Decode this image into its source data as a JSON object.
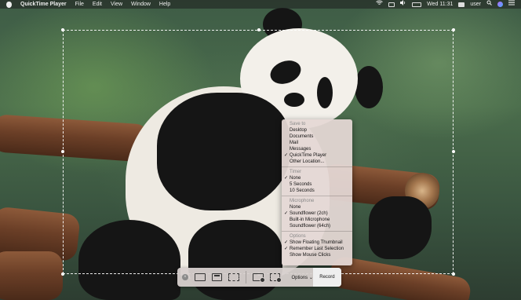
{
  "menubar": {
    "app_name": "QuickTime Player",
    "menus": [
      "File",
      "Edit",
      "View",
      "Window",
      "Help"
    ],
    "clock": "Wed 11:31",
    "user": "user"
  },
  "options_menu": {
    "save_to": {
      "header": "Save to",
      "items": [
        {
          "label": "Desktop",
          "checked": false
        },
        {
          "label": "Documents",
          "checked": false
        },
        {
          "label": "Mail",
          "checked": false
        },
        {
          "label": "Messages",
          "checked": false
        },
        {
          "label": "QuickTime Player",
          "checked": true
        },
        {
          "label": "Other Location...",
          "checked": false
        }
      ]
    },
    "timer": {
      "header": "Timer",
      "items": [
        {
          "label": "None",
          "checked": true
        },
        {
          "label": "5 Seconds",
          "checked": false
        },
        {
          "label": "10 Seconds",
          "checked": false
        }
      ]
    },
    "microphone": {
      "header": "Microphone",
      "items": [
        {
          "label": "None",
          "checked": false
        },
        {
          "label": "Soundflower (2ch)",
          "checked": true
        },
        {
          "label": "Built-in Microphone",
          "checked": false
        },
        {
          "label": "Soundflower (64ch)",
          "checked": false
        }
      ]
    },
    "options": {
      "header": "Options",
      "items": [
        {
          "label": "Show Floating Thumbnail",
          "checked": true
        },
        {
          "label": "Remember Last Selection",
          "checked": true
        },
        {
          "label": "Show Mouse Clicks",
          "checked": false
        }
      ]
    },
    "check_glyph": "✓"
  },
  "toolbar": {
    "close_glyph": "×",
    "options_label": "Options",
    "options_chevron": "⌄",
    "record_label": "Record"
  },
  "icons": {
    "wifi": "wifi-icon",
    "airplay": "airplay-icon",
    "volume": "volume-icon",
    "battery": "battery-icon",
    "spotlight": "spotlight-icon",
    "siri": "siri-icon",
    "notification_center": "notification-center-icon"
  }
}
